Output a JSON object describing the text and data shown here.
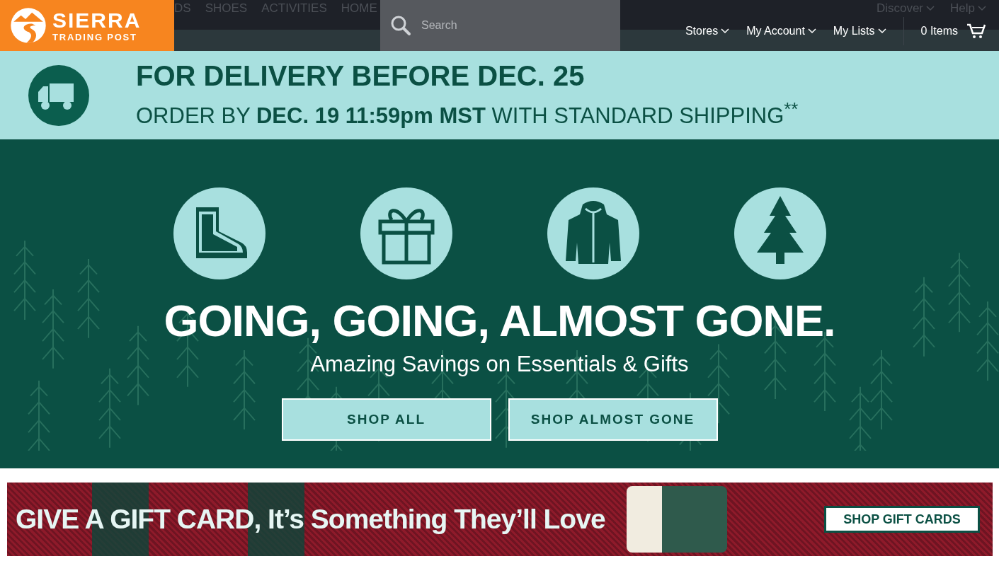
{
  "header": {
    "logo": {
      "line1": "SIERRA",
      "line2": "TRADING POST"
    },
    "nav_items": [
      "DS",
      "SHOES",
      "ACTIVITIES",
      "HOME"
    ],
    "search": {
      "placeholder": "Search"
    },
    "top_links": [
      "Discover",
      "Help"
    ],
    "menus": [
      "Stores",
      "My Account",
      "My Lists"
    ],
    "cart": "0 Items"
  },
  "delivery_banner": {
    "headline": "FOR DELIVERY BEFORE DEC. 25",
    "detail": "ORDER BY **DEC. 19 11:59pm MST** WITH STANDARD SHIPPING$^{**}$"
  },
  "hero": {
    "categories": [
      {
        "kind": "boot"
      },
      {
        "kind": "gift"
      },
      {
        "kind": "jacket"
      },
      {
        "kind": "tree"
      }
    ],
    "headline": "GOING, GOING, ALMOST GONE.",
    "subheadline": "Amazing Savings on Essentials & Gifts",
    "buttons": [
      "SHOP ALL",
      "SHOP ALMOST GONE"
    ]
  },
  "gift_banner": {
    "headline": "GIVE A GIFT CARD, It’s Something They’ll Love",
    "button": "SHOP GIFT CARDS"
  }
}
